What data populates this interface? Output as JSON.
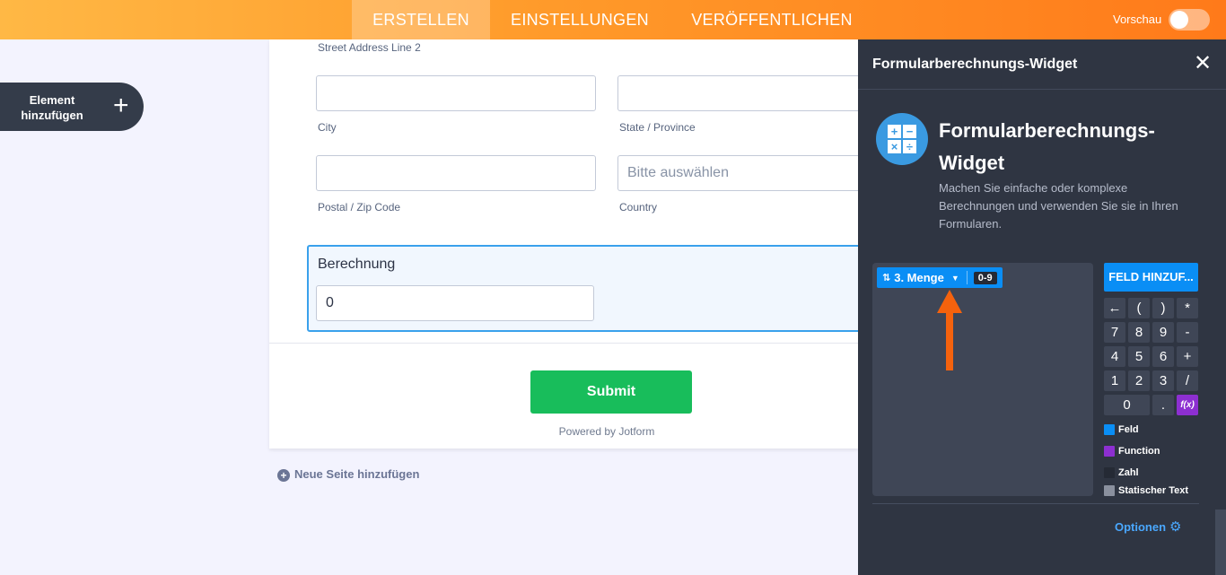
{
  "topbar": {
    "tabs": [
      "ERSTELLEN",
      "EINSTELLUNGEN",
      "VERÖFFENTLICHEN"
    ],
    "active_tab": "ERSTELLEN",
    "preview_label": "Vorschau",
    "preview_enabled": false
  },
  "sidebar": {
    "add_element_label": "Element hinzufügen",
    "add_element_icon": "plus-icon"
  },
  "form": {
    "street_line2_label": "Street Address Line 2",
    "city_label": "City",
    "city_value": "",
    "state_label": "State / Province",
    "state_value": "",
    "zip_label": "Postal / Zip Code",
    "zip_value": "",
    "country_label": "Country",
    "country_placeholder": "Bitte auswählen",
    "calculation_title": "Berechnung",
    "calculation_value": "0",
    "submit_label": "Submit",
    "powered_by": "Powered by Jotform",
    "new_page_label": "Neue Seite hinzufügen"
  },
  "panel": {
    "title": "Formularberechnungs-Widget",
    "close_icon": "close-icon",
    "widget_name": "Formularberechnungs-Widget",
    "widget_description": "Machen Sie einfache oder komplexe Berechnungen und verwenden Sie sie in Ihren Formularen.",
    "widget_icon_symbols": [
      "+",
      "−",
      "×",
      "÷"
    ],
    "formula_chip": {
      "label": "3. Menge",
      "badge": "0-9"
    },
    "add_field_label": "FELD HINZUF...",
    "keypad": {
      "row1": [
        "←",
        "(",
        ")",
        "*"
      ],
      "row2": [
        "7",
        "8",
        "9",
        "-"
      ],
      "row3": [
        "4",
        "5",
        "6",
        "+"
      ],
      "row4": [
        "1",
        "2",
        "3",
        "/"
      ],
      "row5": [
        "0",
        ".",
        "f(x)"
      ]
    },
    "legend": [
      {
        "label": "Feld",
        "color": "#0a8ef5"
      },
      {
        "label": "Function",
        "color": "#8d2fd1"
      },
      {
        "label": "Zahl",
        "color": "#252a35"
      },
      {
        "label": "Statischer Text",
        "color": "#8a909e"
      }
    ],
    "options_label": "Optionen",
    "options_icon": "gear-icon"
  },
  "colors": {
    "accent_orange": "#ff7a1a",
    "submit_green": "#18bd5b",
    "panel_bg": "#2f3542",
    "field_blue": "#0a8ef5"
  }
}
